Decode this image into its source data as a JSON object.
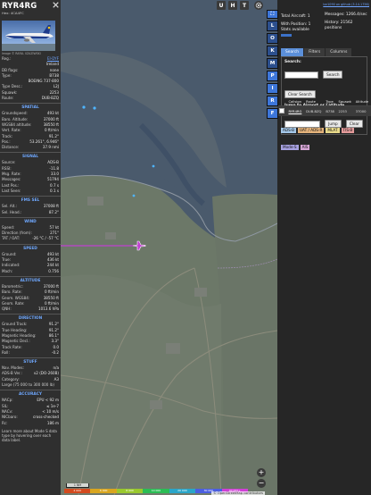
{
  "aircraft": {
    "callsign": "RYR4RG",
    "hex_line": "Hex: 4CA4FC",
    "photo_credit": "Image © RAFAL 0ZAZIWSKI"
  },
  "ident_rows": [
    {
      "k": "Reg.:",
      "v": "EI-DYF",
      "link": true
    },
    {
      "k": "",
      "v": "Ireland"
    },
    {
      "k": "DB flags:",
      "v": "none"
    },
    {
      "k": "Type:",
      "v": "B738"
    },
    {
      "k": "",
      "v": "BOEING 737-800",
      "full": true
    },
    {
      "k": "Type Desc.:",
      "v": "L2J"
    },
    {
      "k": "Squawk:",
      "v": "2253"
    },
    {
      "k": "Route:",
      "v": "DUB-BZQ"
    }
  ],
  "sections": [
    {
      "title": "SPATIAL",
      "rows": [
        {
          "k": "Groundspeed:",
          "v": "493 kt"
        },
        {
          "k": "Baro. Altitude:",
          "v": "37000 ft"
        },
        {
          "k": "WGS84 altitude:",
          "v": "38550 ft"
        },
        {
          "k": "Vert. Rate:",
          "v": "0 ft/min"
        },
        {
          "k": "Track:",
          "v": "91.2°"
        },
        {
          "k": "Pos.:",
          "v": "53.261°, 6.946°"
        },
        {
          "k": "Distance:",
          "v": "37.9 nmi"
        }
      ]
    },
    {
      "title": "SIGNAL",
      "rows": [
        {
          "k": "Source:",
          "v": "ADS-B"
        },
        {
          "k": "RSSI:",
          "v": "-11.8"
        },
        {
          "k": "Msg. Rate:",
          "v": "33.0"
        },
        {
          "k": "Messages:",
          "v": "51794"
        },
        {
          "k": "Last Pos.:",
          "v": "0.7 s"
        },
        {
          "k": "Last Seen:",
          "v": "0.1 s"
        }
      ]
    },
    {
      "title": "FMS SEL",
      "rows": [
        {
          "k": "Sel. Alt.:",
          "v": "37008 ft"
        },
        {
          "k": "Sel. Head.:",
          "v": "87.2°"
        }
      ]
    },
    {
      "title": "WIND",
      "rows": [
        {
          "k": "Speed:",
          "v": "57 kt"
        },
        {
          "k": "Direction (from):",
          "v": "271°"
        },
        {
          "k": "TAT / OAT:",
          "v": "-26 °C / -57 °C"
        }
      ]
    },
    {
      "title": "SPEED",
      "rows": [
        {
          "k": "Ground:",
          "v": "493 kt"
        },
        {
          "k": "True:",
          "v": "436 kt"
        },
        {
          "k": "Indicated:",
          "v": "244 kt"
        },
        {
          "k": "Mach:",
          "v": "0.756"
        }
      ]
    },
    {
      "title": "ALTITUDE",
      "rows": [
        {
          "k": "Barometric:",
          "v": "37000 ft"
        },
        {
          "k": "Baro. Rate:",
          "v": "0 ft/min"
        },
        {
          "k": "Geom. WGS84:",
          "v": "38550 ft"
        },
        {
          "k": "Geom. Rate:",
          "v": "0 ft/min"
        },
        {
          "k": "QNH:",
          "v": "1013.6 hPa"
        }
      ]
    },
    {
      "title": "DIRECTION",
      "rows": [
        {
          "k": "Ground Track:",
          "v": "91.2°"
        },
        {
          "k": "True Heading:",
          "v": "91.2°"
        },
        {
          "k": "Magnetic Heading:",
          "v": "86.1°"
        },
        {
          "k": "Magnetic Decl.:",
          "v": "3.3°"
        },
        {
          "k": "Track Rate:",
          "v": "0.0"
        },
        {
          "k": "Roll:",
          "v": "-0.2"
        }
      ]
    },
    {
      "title": "STUFF",
      "rows": [
        {
          "k": "Nav. Modes:",
          "v": "n/a"
        },
        {
          "k": "ADS-B Ver.:",
          "v": "v2 (DO-260B)"
        },
        {
          "k": "Category:",
          "v": "A3"
        },
        {
          "k": "Large (75 000 to 300 000 lb)",
          "v": ""
        }
      ]
    },
    {
      "title": "ACCURACY",
      "rows": [
        {
          "k": "NACp:",
          "v": "EPU < 92 m"
        },
        {
          "k": "SIL:",
          "v": "≤ 1e-7"
        },
        {
          "k": "NACv:",
          "v": "< 10 m/s"
        },
        {
          "k": "NICbaro:",
          "v": "cross-checked"
        },
        {
          "k": "Rc:",
          "v": "186 m"
        }
      ]
    }
  ],
  "blurb": "Learn more about Mode S data type by hovering over each data label.",
  "map": {
    "layer_buttons": [
      "U",
      "H",
      "T"
    ],
    "settings_icon": "gear-icon",
    "scale_label": "1 NM",
    "attribution": "© OpenStreetMap contributors",
    "zoom_in": "+",
    "zoom_out": "−",
    "legend": [
      "4 000",
      "6 000",
      "8 000",
      "10 000",
      "20 000",
      "30 000",
      "40 000+"
    ],
    "legend_colors": [
      "#d34a1e",
      "#d9a61f",
      "#9ac92e",
      "#2bbd55",
      "#2aa6c9",
      "#4b5fe0",
      "#d040d6"
    ]
  },
  "strip_buttons": [
    "L",
    "O",
    "K",
    "M",
    "P",
    "I",
    "R",
    "F"
  ],
  "right": {
    "toplink": "tar1090 on github (3.14.1756)",
    "total_label": "Total Aircraft: 1",
    "position_label": "With Position: 1",
    "stats_label": "Stats available",
    "messages_label": "Messages: 1266.4/sec",
    "history_label": "History: 21562 positions",
    "tabs": [
      "Search",
      "Filters",
      "Columns"
    ],
    "search_label": "Search:",
    "search_button": "Search",
    "clear_button": "Clear Search",
    "jump_label": "Jump to Airport or Latitude, Longitude:",
    "jump_button": "Jump",
    "jump_clear": "Clear",
    "columns": [
      "Callsign",
      "Route",
      "Type",
      "Squawk",
      "Altitude"
    ],
    "rows": [
      [
        "RYR4RG",
        "DUB-BZQ",
        "B738",
        "2253",
        "37000"
      ]
    ],
    "chips": [
      {
        "label": "ADS-B",
        "color": "#a4c7e8"
      },
      {
        "label": "UAT / ADS-R",
        "color": "#e4b37b"
      },
      {
        "label": "MLAT",
        "color": "#e9da8a"
      },
      {
        "label": "TIS-B",
        "color": "#e39a9a"
      },
      {
        "label": "Mode-S",
        "color": "#a7a1e0"
      },
      {
        "label": "AIS",
        "color": "#d6a6d6"
      }
    ]
  }
}
